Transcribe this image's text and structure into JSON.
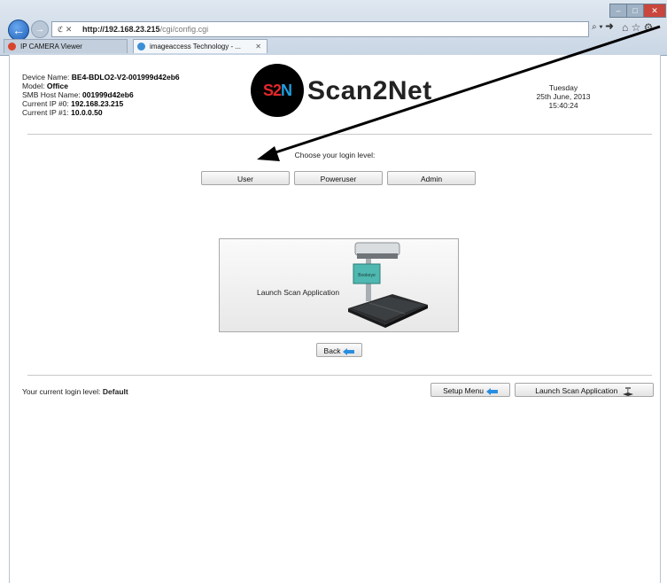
{
  "browser": {
    "address_host": "http://192.168.23.215",
    "address_path": "/cgi/config.cgi",
    "address_icons": "ℭ ✕",
    "search_glyph": "⌕ ▾ ➜",
    "toolbar_glyphs": "⌂ ☆ ⚙",
    "tabs": [
      {
        "label": "IP CAMERA Viewer",
        "icon_color": "#d9442e"
      },
      {
        "label": "imageaccess Technology - ...",
        "icon_color": "#3a8fd6",
        "close": "✕"
      }
    ],
    "window_controls": {
      "minimize": "–",
      "maximize": "□",
      "close": "✕"
    }
  },
  "device": {
    "name_label": "Device Name:",
    "name_value": "BE4-BDLO2-V2-001999d42eb6",
    "model_label": "Model:",
    "model_value": "Office",
    "smb_label": "SMB Host Name:",
    "smb_value": "001999d42eb6",
    "ip0_label": "Current IP #0:",
    "ip0_value": "192.168.23.215",
    "ip1_label": "Current IP #1:",
    "ip1_value": "10.0.0.50"
  },
  "logo": {
    "circle_s": "S",
    "circle_2": "2",
    "circle_n": "N",
    "text": "Scan2Net"
  },
  "datetime": {
    "day": "Tuesday",
    "date": "25th June, 2013",
    "time": "15:40:24"
  },
  "login": {
    "prompt": "Choose your login level:",
    "buttons": [
      "User",
      "Poweruser",
      "Admin"
    ]
  },
  "scan_panel": {
    "label": "Launch Scan Application",
    "device_brand": "Bookeye"
  },
  "back_button": {
    "label": "Back"
  },
  "footer": {
    "current_level_label": "Your current login level:",
    "current_level_value": "Default",
    "setup_menu_label": "Setup Menu",
    "launch_label": "Launch Scan Application"
  },
  "colors": {
    "accent_blue": "#2a8ee0",
    "annotation_arrow": "#000000"
  }
}
